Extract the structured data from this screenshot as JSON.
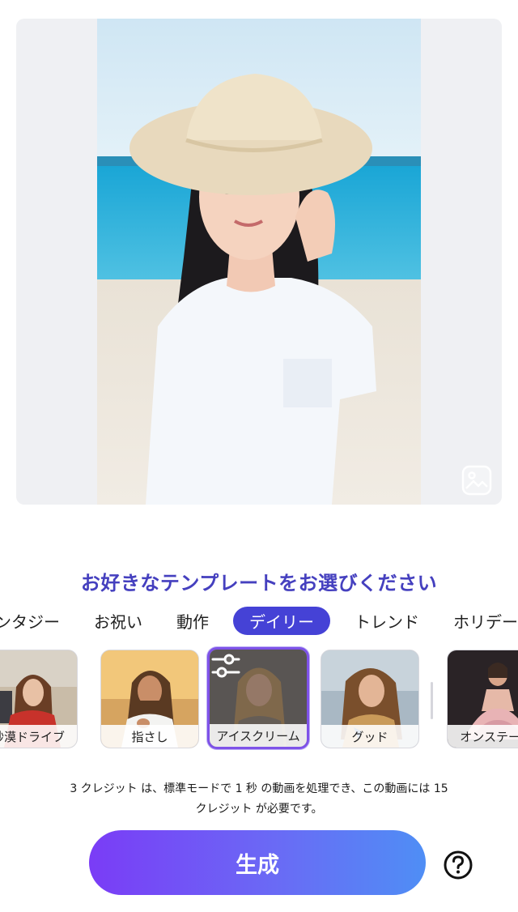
{
  "heading": "お好きなテンプレートをお選びください",
  "tabs": [
    {
      "label": "ンタジー",
      "active": false
    },
    {
      "label": "お祝い",
      "active": false
    },
    {
      "label": "動作",
      "active": false
    },
    {
      "label": "デイリー",
      "active": true
    },
    {
      "label": "トレンド",
      "active": false
    },
    {
      "label": "ホリデー",
      "active": false
    }
  ],
  "templates": [
    {
      "label": "砂漠ドライブ",
      "selected": false
    },
    {
      "label": "指さし",
      "selected": false
    },
    {
      "label": "アイスクリーム",
      "selected": true
    },
    {
      "label": "グッド",
      "selected": false
    },
    {
      "label": "オンステージ",
      "selected": false
    }
  ],
  "credits": {
    "line1": "3 クレジット は、標準モードで 1 秒 の動画を処理でき、この動画には 15",
    "line2": "クレジット が必要です。"
  },
  "generate_button": "生成",
  "icons": {
    "gallery": "image-gallery-icon",
    "adjust": "sliders-adjust-icon",
    "help": "question-circle-icon"
  },
  "colors": {
    "accent": "#4542d6",
    "heading": "#4540bf",
    "selected_border": "#7e52e8",
    "button_gradient_start": "#7a3cf6",
    "button_gradient_end": "#4f8ef5"
  }
}
